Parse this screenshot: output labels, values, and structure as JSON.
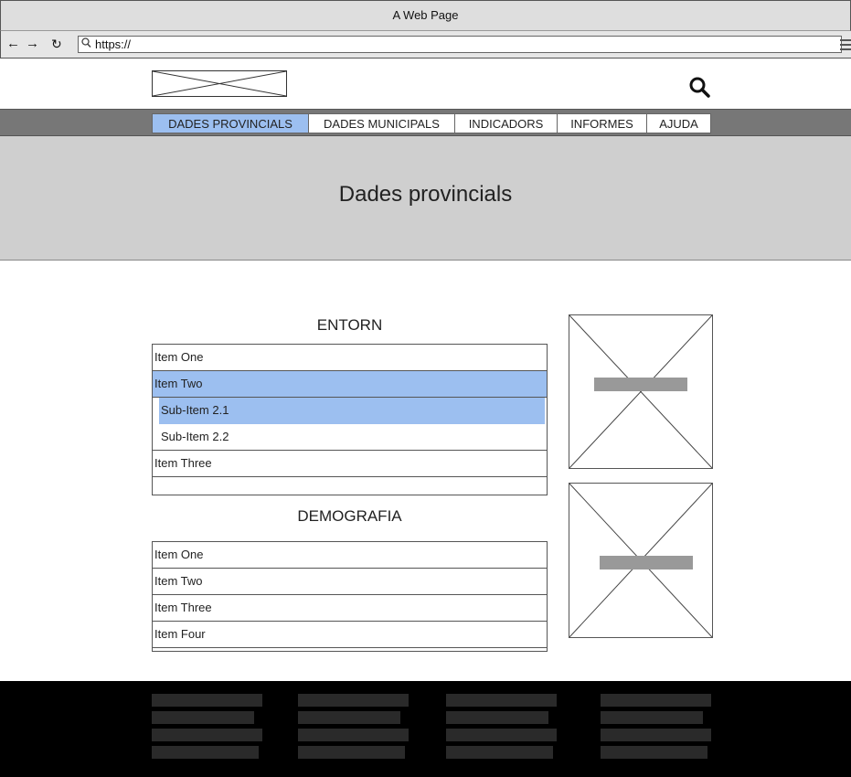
{
  "browser": {
    "window_title": "A Web Page",
    "url": "https://",
    "back_icon": "back-arrow-icon",
    "forward_icon": "forward-arrow-icon",
    "reload_icon": "reload-icon",
    "search_field_icon": "magnifier-icon",
    "menu_icon": "hamburger-menu-icon"
  },
  "header": {
    "logo": "logo-placeholder",
    "search_icon": "search-icon"
  },
  "nav": {
    "tabs": [
      {
        "label": "DADES PROVINCIALS",
        "active": true
      },
      {
        "label": "DADES MUNICIPALS",
        "active": false
      },
      {
        "label": "INDICADORS",
        "active": false
      },
      {
        "label": "INFORMES",
        "active": false
      },
      {
        "label": "AJUDA",
        "active": false
      }
    ],
    "active_color": "#9cbff0"
  },
  "banner": {
    "title": "Dades provincials"
  },
  "sections": {
    "entorn": {
      "heading": "ENTORN",
      "items": [
        {
          "label": "Item One",
          "active": false
        },
        {
          "label": "Item Two",
          "active": true
        },
        {
          "label": "Sub-Item 2.1",
          "active": true,
          "sub": true
        },
        {
          "label": "Sub-Item 2.2",
          "active": false,
          "sub": true
        },
        {
          "label": "Item Three",
          "active": false
        }
      ]
    },
    "demografia": {
      "heading": "DEMOGRAFIA",
      "items": [
        {
          "label": "Item One"
        },
        {
          "label": "Item Two"
        },
        {
          "label": "Item Three"
        },
        {
          "label": "Item Four"
        }
      ]
    }
  },
  "colors": {
    "highlight": "#9cbff0",
    "navbar": "#777777",
    "banner": "#cfcfcf",
    "footer": "#000000"
  }
}
